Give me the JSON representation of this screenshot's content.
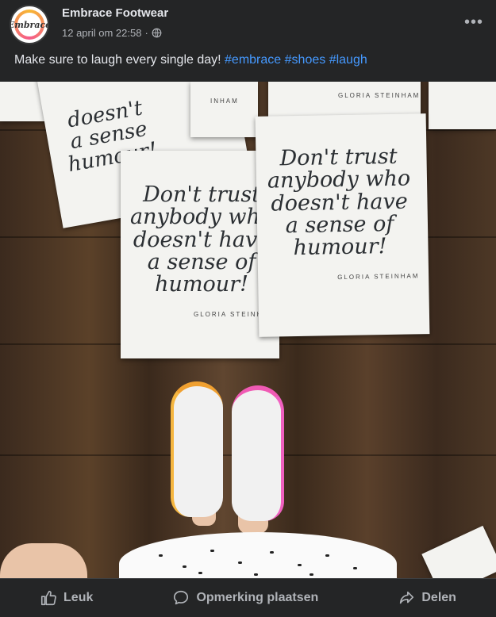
{
  "post": {
    "page_name": "Embrace Footwear",
    "avatar_text": "Embrace",
    "timestamp": "12 april om 22:58",
    "separator": "·",
    "more_label": "•••",
    "caption_text": "Make sure to laugh every single day! ",
    "hashtags": [
      "#embrace",
      "#shoes",
      "#laugh"
    ]
  },
  "photo": {
    "quote_main": "Don't trust\nanybody who\ndoesn't have\na sense of\nhumour!",
    "quote_right": "Don't trust\nanybody who\ndoesn't have\na sense of\nhumour!",
    "quote_top": "doesn't\na sense\nhumour!",
    "author": "GLORIA STEINHAM",
    "author_cropped": "INHAM"
  },
  "actions": {
    "like": "Leuk",
    "comment": "Opmerking plaatsen",
    "share": "Delen"
  },
  "colors": {
    "background": "#242526",
    "text": "#e4e6eb",
    "secondary": "#b0b3b8",
    "hashtag": "#4599ff"
  }
}
